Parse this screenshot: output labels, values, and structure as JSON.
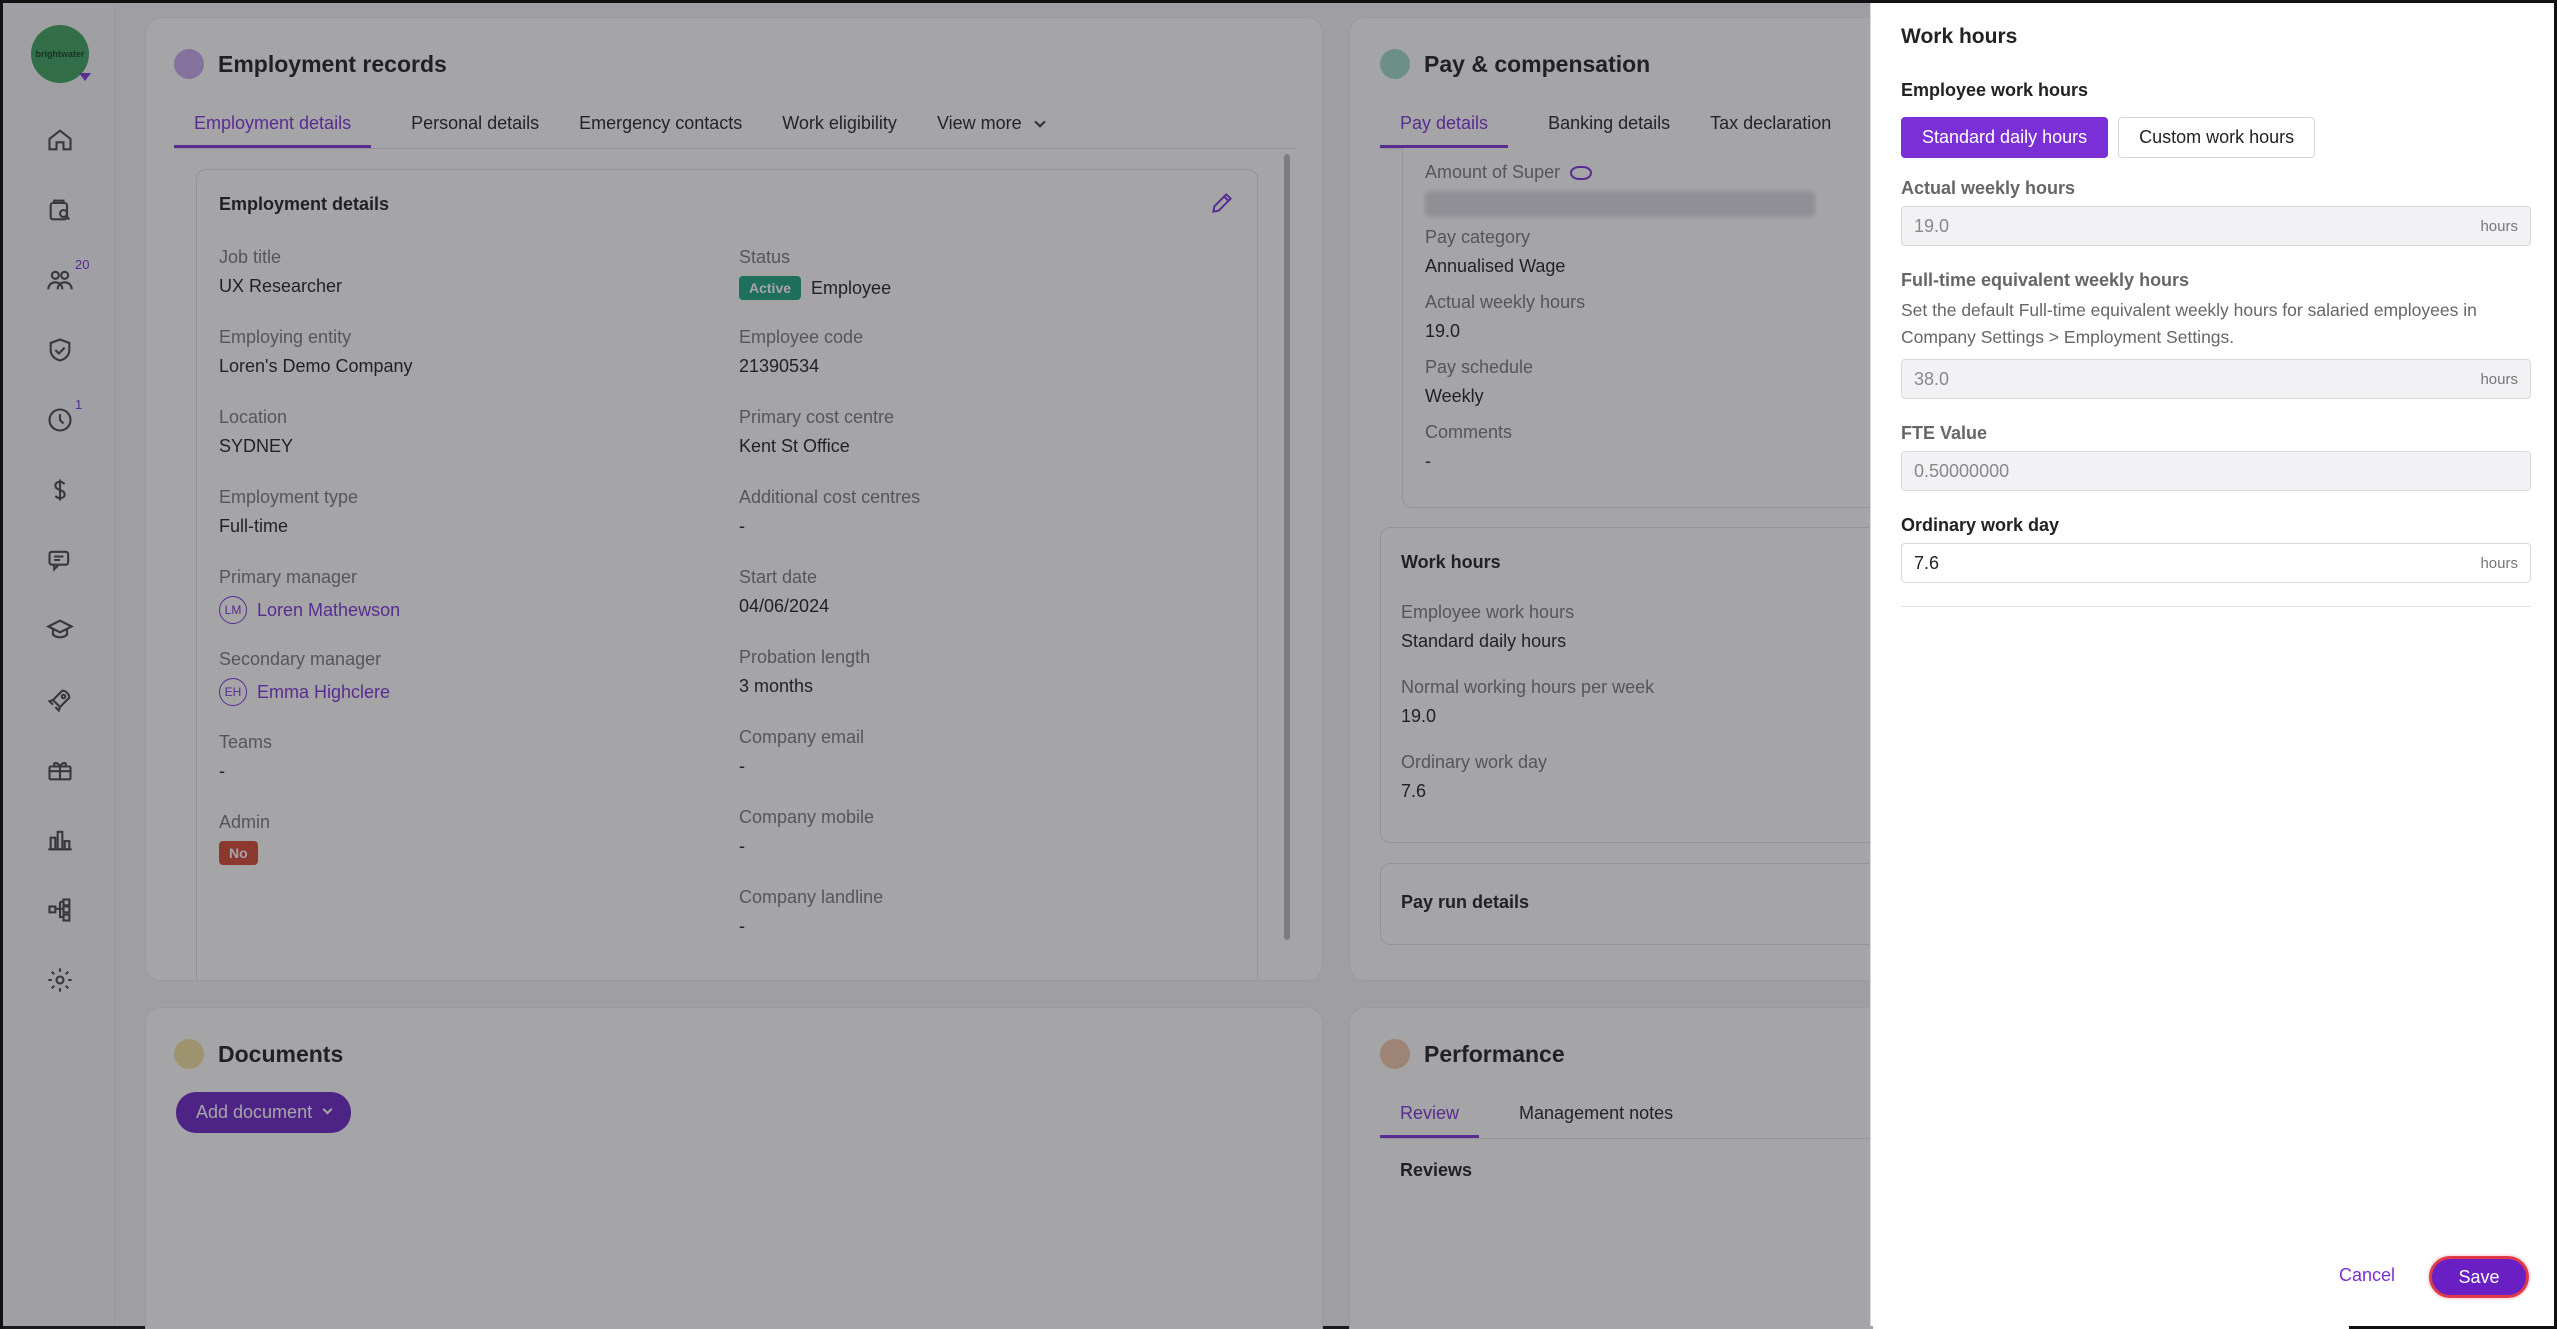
{
  "sidebar": {
    "logo_text": "brightwater",
    "badges": {
      "people": "20",
      "time": "1"
    },
    "icons": [
      "home-icon",
      "search-file-icon",
      "people-icon",
      "shield-check-icon",
      "clock-icon",
      "dollar-icon",
      "chat-icon",
      "graduation-cap-icon",
      "rocket-icon",
      "gift-icon",
      "bar-chart-icon",
      "org-chart-icon",
      "gear-icon"
    ]
  },
  "employment": {
    "title": "Employment records",
    "tabs": [
      "Employment details",
      "Personal details",
      "Emergency contacts",
      "Work eligibility",
      "View more"
    ],
    "section_title": "Employment details",
    "left": [
      {
        "label": "Job title",
        "value": "UX Researcher"
      },
      {
        "label": "Employing entity",
        "value": "Loren's Demo Company"
      },
      {
        "label": "Location",
        "value": "SYDNEY"
      },
      {
        "label": "Employment type",
        "value": "Full-time"
      },
      {
        "label": "Primary manager",
        "value": "Loren Mathewson",
        "initials": "LM"
      },
      {
        "label": "Secondary manager",
        "value": "Emma Highclere",
        "initials": "EH"
      },
      {
        "label": "Teams",
        "value": "-"
      },
      {
        "label": "Admin",
        "value": "No"
      }
    ],
    "right": [
      {
        "label": "Status",
        "badge": "Active",
        "value": "Employee"
      },
      {
        "label": "Employee code",
        "value": "21390534"
      },
      {
        "label": "Primary cost centre",
        "value": "Kent St Office"
      },
      {
        "label": "Additional cost centres",
        "value": "-"
      },
      {
        "label": "Start date",
        "value": "04/06/2024"
      },
      {
        "label": "Probation length",
        "value": "3 months"
      },
      {
        "label": "Company email",
        "value": "-"
      },
      {
        "label": "Company mobile",
        "value": "-"
      },
      {
        "label": "Company landline",
        "value": "-"
      }
    ]
  },
  "pay": {
    "title": "Pay & compensation",
    "tabs": [
      "Pay details",
      "Banking details",
      "Tax declaration"
    ],
    "amount_super_label": "Amount of Super",
    "fields": [
      {
        "label": "Pay category",
        "value": "Annualised Wage"
      },
      {
        "label": "Actual weekly hours",
        "value": "19.0"
      },
      {
        "label": "Pay schedule",
        "value": "Weekly"
      },
      {
        "label": "Comments",
        "value": "-"
      }
    ],
    "work_hours": {
      "title": "Work hours",
      "fields": [
        {
          "label": "Employee work hours",
          "value": "Standard daily hours"
        },
        {
          "label": "Normal working hours per week",
          "value": "19.0"
        },
        {
          "label": "Ordinary work day",
          "value": "7.6"
        }
      ]
    },
    "pay_run_title": "Pay run details"
  },
  "documents": {
    "title": "Documents",
    "add_label": "Add document"
  },
  "performance": {
    "title": "Performance",
    "tabs": [
      "Review",
      "Management notes"
    ],
    "reviews_label": "Reviews"
  },
  "drawer": {
    "title": "Work hours",
    "employee_work_hours_label": "Employee work hours",
    "options": [
      "Standard daily hours",
      "Custom work hours"
    ],
    "selected_option": "Standard daily hours",
    "actual_weekly_label": "Actual weekly hours",
    "actual_weekly_value": "19.0",
    "fte_weekly_label": "Full-time equivalent weekly hours",
    "fte_help": "Set the default Full-time equivalent weekly hours for salaried employees in Company Settings > Employment Settings.",
    "fte_weekly_value": "38.0",
    "fte_value_label": "FTE Value",
    "fte_value": "0.50000000",
    "ordinary_label": "Ordinary work day",
    "ordinary_value": "7.6",
    "unit": "hours",
    "cancel_label": "Cancel",
    "save_label": "Save"
  },
  "colors": {
    "accent": "#7b2fd6",
    "active_badge": "#18a37a",
    "no_badge": "#d2442f"
  }
}
